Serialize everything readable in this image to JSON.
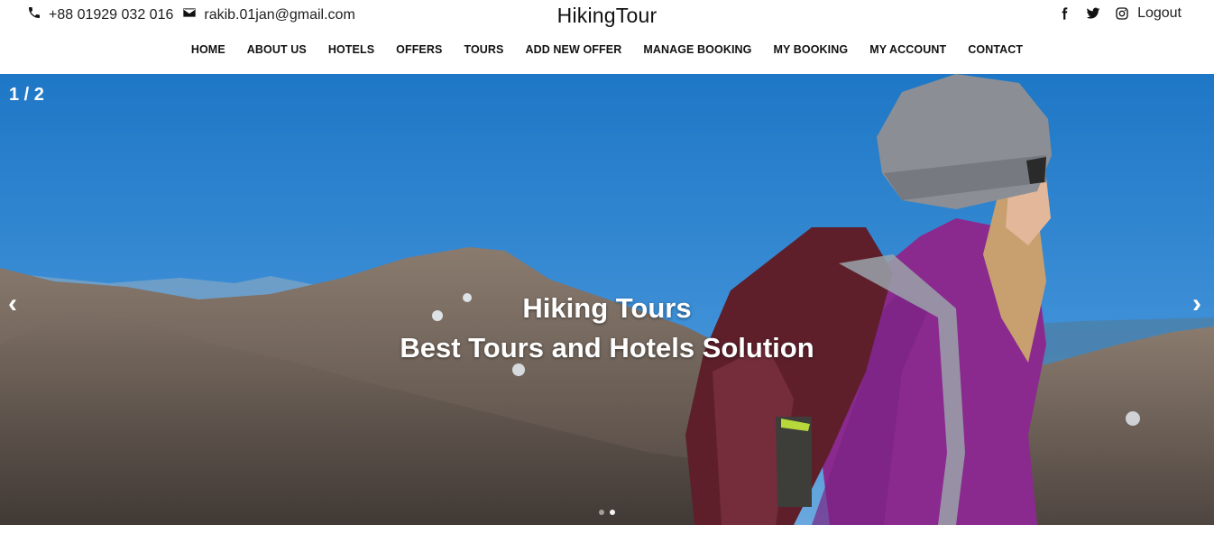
{
  "header": {
    "phone": "+88 01929 032 016",
    "email": "rakib.01jan@gmail.com",
    "brand": "HikingTour",
    "logout_label": "Logout",
    "icons": [
      "phone-icon",
      "envelope-icon",
      "facebook-icon",
      "twitter-icon",
      "instagram-icon"
    ]
  },
  "nav": {
    "items": [
      {
        "label": "HOME"
      },
      {
        "label": "ABOUT US"
      },
      {
        "label": "HOTELS"
      },
      {
        "label": "OFFERS"
      },
      {
        "label": "TOURS"
      },
      {
        "label": "ADD NEW OFFER"
      },
      {
        "label": "MANAGE BOOKING"
      },
      {
        "label": "MY BOOKING"
      },
      {
        "label": "MY ACCOUNT"
      },
      {
        "label": "CONTACT"
      }
    ]
  },
  "carousel": {
    "counter": "1 / 2",
    "prev_glyph": "‹",
    "next_glyph": "›",
    "title": "Hiking Tours",
    "subtitle": "Best Tours and Hotels Solution",
    "slides_total": 2,
    "active_index": 1
  },
  "colors": {
    "sky_top": "#1e77c6",
    "sky_bottom": "#6aa8de",
    "mountain": "#6a5c52",
    "jacket": "#8a2a8f",
    "backpack": "#5e1f2b",
    "beanie": "#8b8f95"
  }
}
